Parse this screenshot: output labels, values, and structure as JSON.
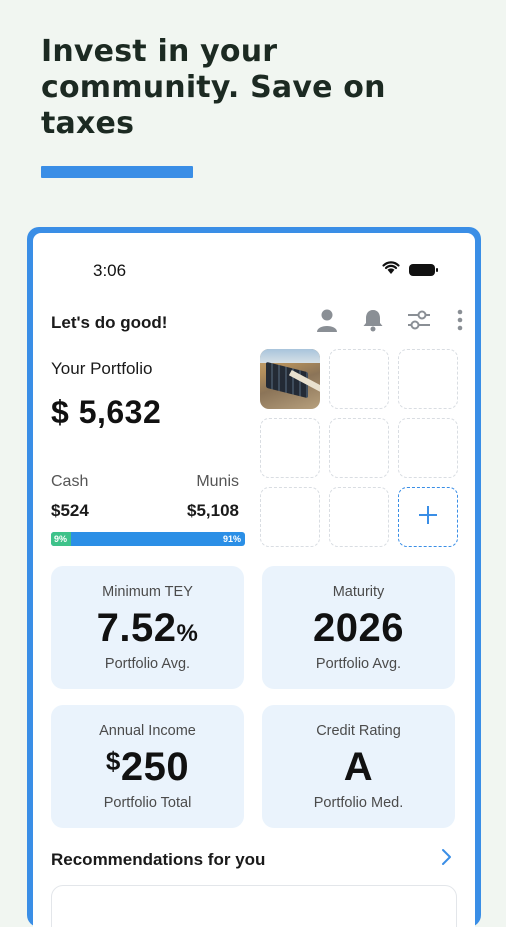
{
  "headline": "Invest in your community. Save on taxes",
  "colors": {
    "accent": "#3a8ee6",
    "background": "#f1f6f1",
    "card": "#eaf3fc",
    "cash": "#3ec28a",
    "munis": "#2b8fe6"
  },
  "status_bar": {
    "time": "3:06",
    "icons": [
      "wifi-icon",
      "battery-icon"
    ]
  },
  "header": {
    "greeting": "Let's do good!",
    "icons": [
      "profile-icon",
      "bell-icon",
      "filter-sliders-icon",
      "more-vert-icon"
    ]
  },
  "portfolio": {
    "label": "Your Portfolio",
    "value": "$ 5,632",
    "cash_label": "Cash",
    "cash_value": "$524",
    "munis_label": "Munis",
    "munis_value": "$5,108",
    "cash_pct_text": "9%",
    "munis_pct_text": "91%",
    "cash_fraction": 0.09
  },
  "holdings": {
    "filled_slots": 1,
    "empty_slots": 7,
    "add_icon": "plus-icon"
  },
  "stats": {
    "min_tey": {
      "label": "Minimum TEY",
      "value": "7.52",
      "unit": "%",
      "sub": "Portfolio Avg."
    },
    "maturity": {
      "label": "Maturity",
      "value": "2026",
      "sub": "Portfolio Avg."
    },
    "annual_income": {
      "label": "Annual Income",
      "prefix": "$",
      "value": "250",
      "sub": "Portfolio Total"
    },
    "credit_rating": {
      "label": "Credit Rating",
      "value": "A",
      "sub": "Portfolio Med."
    }
  },
  "recommendations": {
    "title": "Recommendations for you",
    "icon": "chevron-right-icon"
  }
}
